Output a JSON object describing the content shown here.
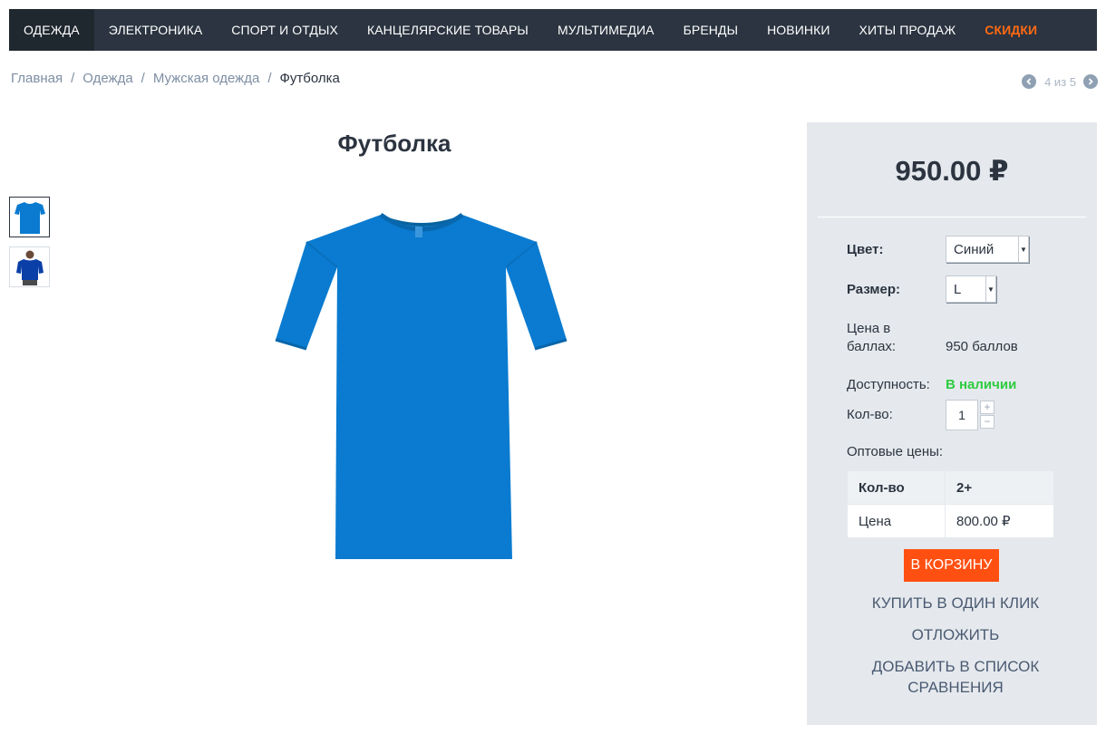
{
  "nav": {
    "items": [
      {
        "label": "ОДЕЖДА"
      },
      {
        "label": "ЭЛЕКТРОНИКА"
      },
      {
        "label": "СПОРТ И ОТДЫХ"
      },
      {
        "label": "КАНЦЕЛЯРСКИЕ ТОВАРЫ"
      },
      {
        "label": "МУЛЬТИМЕДИА"
      },
      {
        "label": "БРЕНДЫ"
      },
      {
        "label": "НОВИНКИ"
      },
      {
        "label": "ХИТЫ ПРОДАЖ"
      },
      {
        "label": "СКИДКИ"
      }
    ],
    "active_index": 0,
    "sale_color": "#ff6a13"
  },
  "breadcrumb": {
    "items": [
      "Главная",
      "Одежда",
      "Мужская одежда"
    ],
    "separator": "/",
    "current": "Футболка"
  },
  "pager": {
    "text": "4 из 5",
    "prev_icon": "chevron-left-icon",
    "next_icon": "chevron-right-icon"
  },
  "product": {
    "title": "Футболка",
    "thumbnails": [
      {
        "name": "tshirt-front-thumbnail"
      },
      {
        "name": "tshirt-model-thumbnail"
      }
    ],
    "color": "#0a7bd0"
  },
  "panel": {
    "price": "950.00 ₽",
    "color_label": "Цвет:",
    "color_value": "Синий",
    "size_label": "Размер:",
    "size_value": "L",
    "points_label_1": "Цена в",
    "points_label_2": "баллах:",
    "points_value": "950 баллов",
    "availability_label": "Доступность:",
    "availability_value": "В наличии",
    "qty_label": "Кол-во:",
    "qty_value": "1",
    "qty_plus": "+",
    "qty_minus": "−",
    "wholesale_label": "Оптовые цены:",
    "wholesale_table": {
      "head": [
        "Кол-во",
        "2+"
      ],
      "row": [
        "Цена",
        "800.00 ₽"
      ]
    },
    "cart_button": "В КОРЗИНУ",
    "one_click": "КУПИТЬ В ОДИН КЛИК",
    "postpone": "ОТЛОЖИТЬ",
    "compare_1": "ДОБАВИТЬ В СПИСОК",
    "compare_2": "СРАВНЕНИЯ",
    "accent_color": "#ff5012"
  }
}
